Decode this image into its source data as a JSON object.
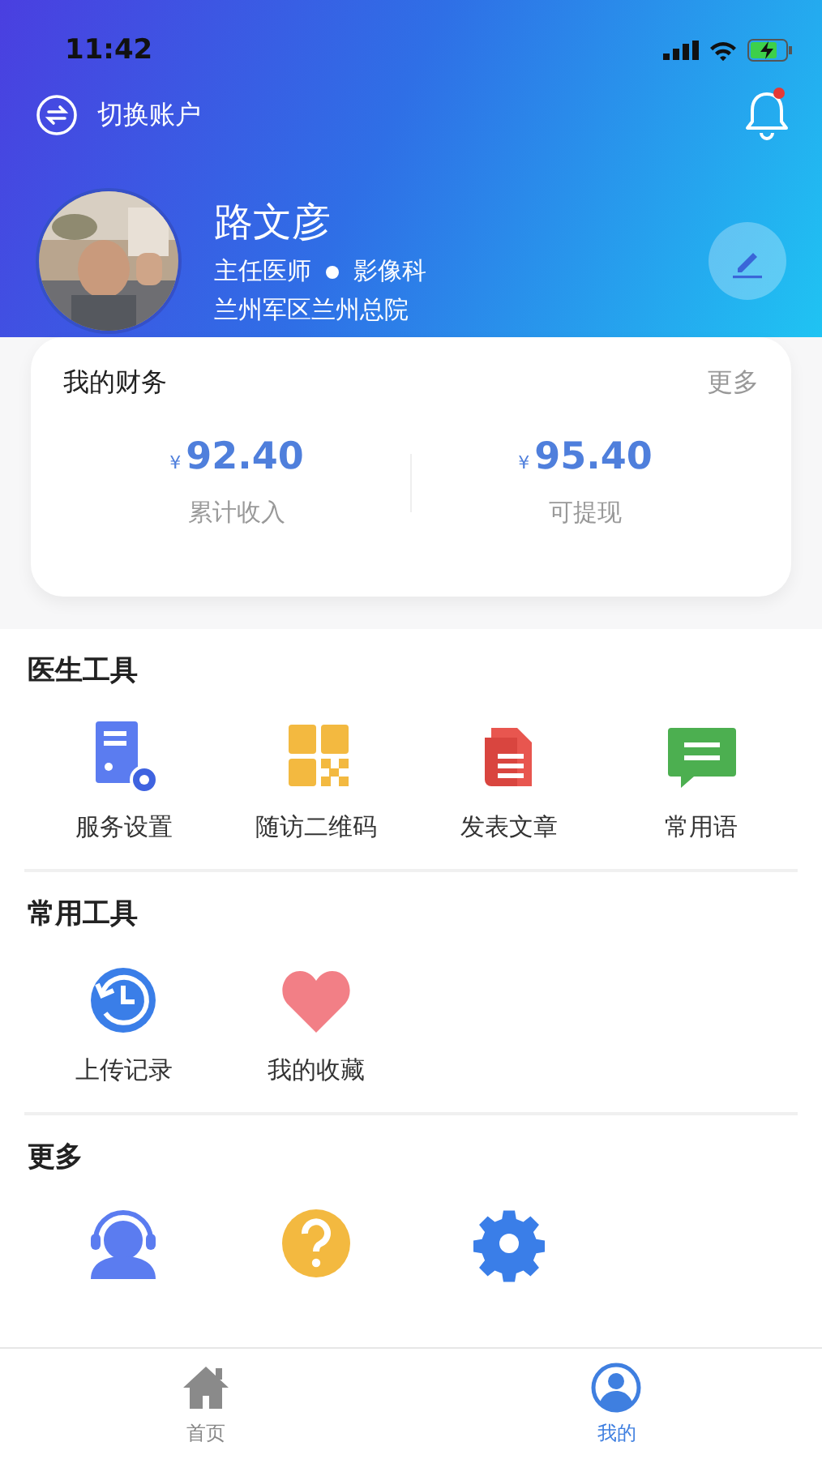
{
  "status_bar": {
    "time": "11:42"
  },
  "header": {
    "switch_account": "切换账户",
    "notification": {
      "unread": true
    },
    "name": "路文彦",
    "title": "主任医师",
    "department": "影像科",
    "hospital": "兰州军区兰州总院"
  },
  "finance": {
    "title": "我的财务",
    "more": "更多",
    "items": [
      {
        "currency": "¥",
        "amount": "92.40",
        "label": "累计收入"
      },
      {
        "currency": "¥",
        "amount": "95.40",
        "label": "可提现"
      }
    ]
  },
  "sections": [
    {
      "title": "医生工具",
      "items": [
        {
          "kind": "labeled",
          "label": "服务设置"
        },
        {
          "kind": "labeled",
          "label": "随访二维码"
        },
        {
          "kind": "labeled",
          "label": "发表文章"
        },
        {
          "kind": "labeled",
          "label": "常用语"
        }
      ]
    },
    {
      "title": "常用工具",
      "items": [
        {
          "kind": "labeled",
          "label": "上传记录"
        },
        {
          "kind": "labeled",
          "label": "我的收藏"
        }
      ]
    },
    {
      "title": "更多",
      "items": [
        {
          "kind": "icon"
        },
        {
          "kind": "icon"
        },
        {
          "kind": "icon"
        }
      ]
    }
  ],
  "tabs": [
    {
      "label": "首页",
      "selected": false
    },
    {
      "label": "我的",
      "selected": true
    }
  ]
}
